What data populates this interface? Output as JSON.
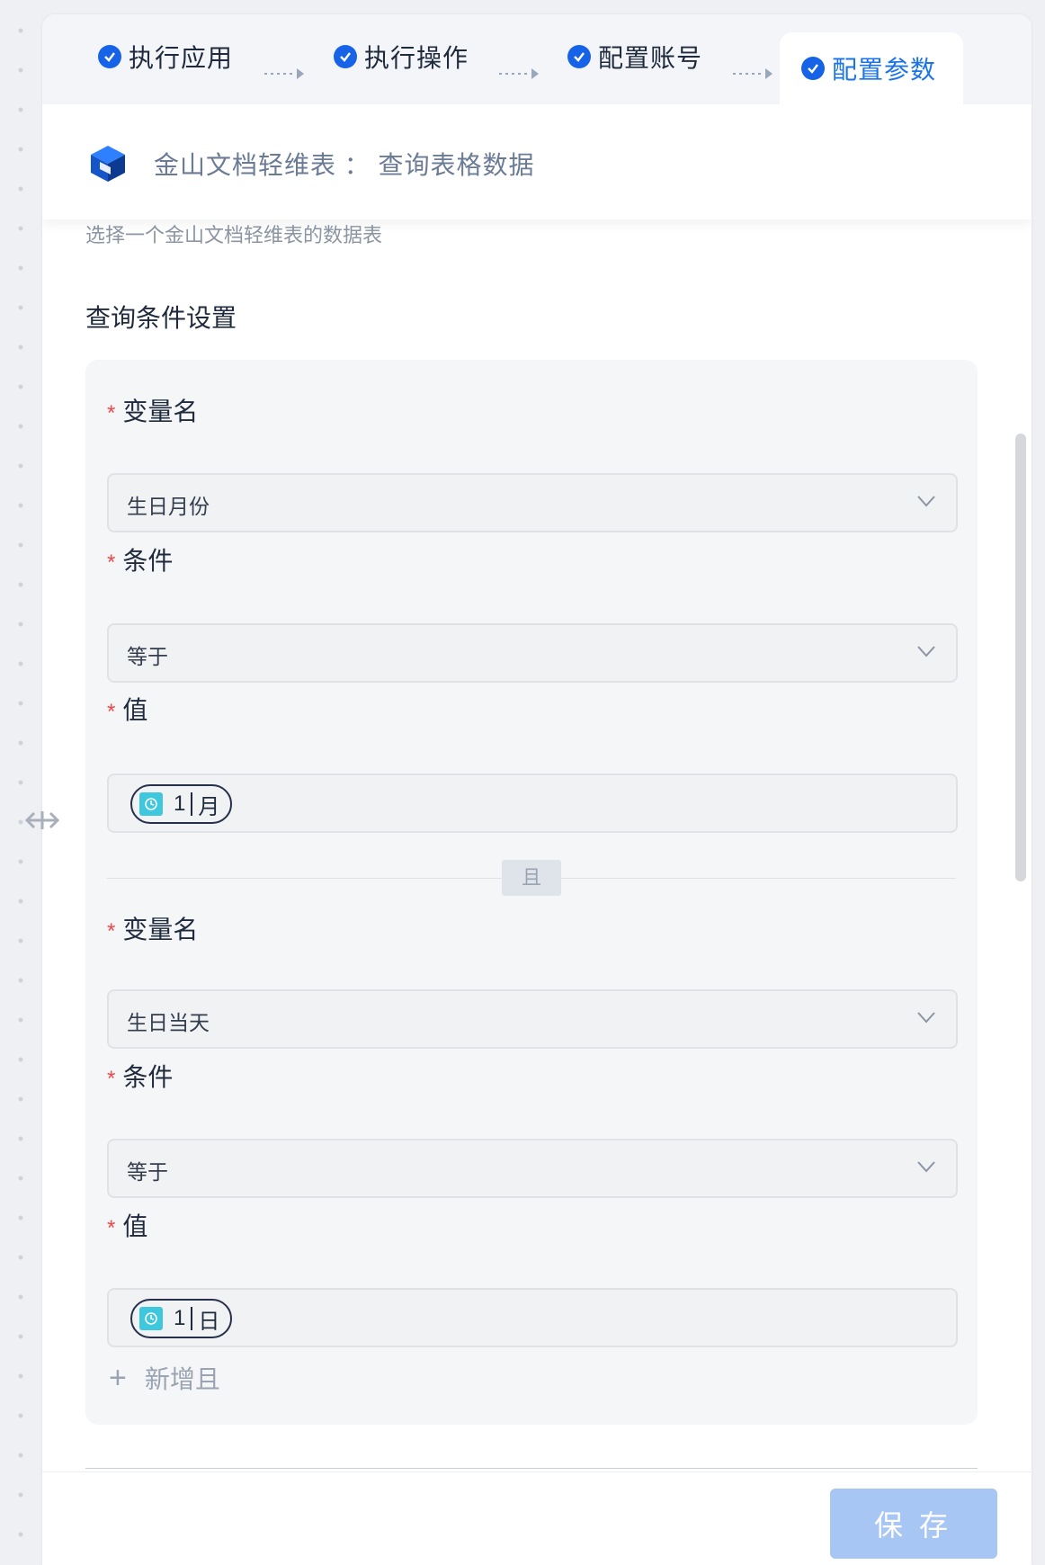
{
  "steps": [
    {
      "label": "执行应用"
    },
    {
      "label": "执行操作"
    },
    {
      "label": "配置账号"
    },
    {
      "label": "配置参数"
    }
  ],
  "header": {
    "title": "金山文档轻维表 ： 查询表格数据"
  },
  "description": "选择一个金山文档轻维表的数据表",
  "section_title": "查询条件设置",
  "conditions": [
    {
      "var_label": "变量名",
      "var_value": "生日月份",
      "cond_label": "条件",
      "cond_value": "等于",
      "val_label": "值",
      "val_number": "1",
      "val_unit": "月"
    },
    {
      "var_label": "变量名",
      "var_value": "生日当天",
      "cond_label": "条件",
      "cond_value": "等于",
      "val_label": "值",
      "val_number": "1",
      "val_unit": "日"
    }
  ],
  "required_mark": "*",
  "and_label": "且",
  "add_label": "新增且",
  "save_label": "保存",
  "colors": {
    "accent": "#1763e8",
    "active_step": "#1a74e8",
    "required": "#f04848",
    "save_disabled": "#a7c6f4"
  }
}
